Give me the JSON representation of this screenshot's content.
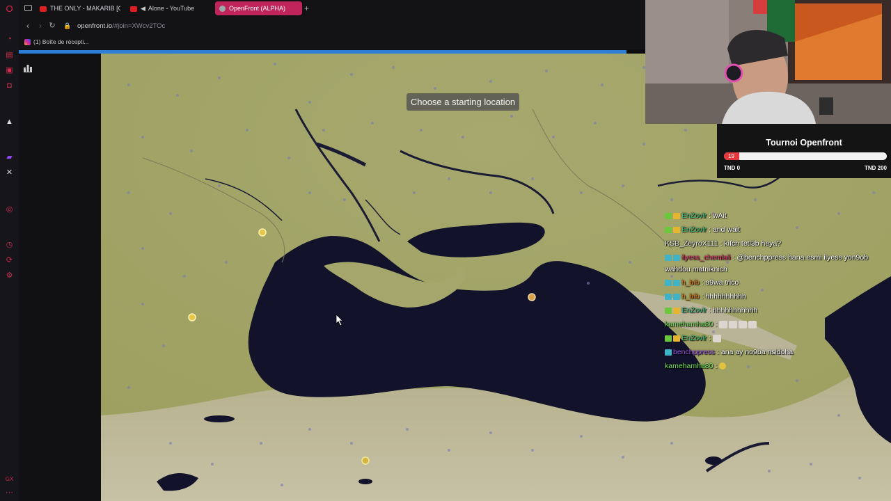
{
  "browser": {
    "tabs": [
      {
        "label": "THE ONLY - MAKARIB [O",
        "icon": "youtube-icon"
      },
      {
        "label": "Alone - YouTube",
        "icon": "youtube-icon"
      },
      {
        "label": "OpenFront (ALPHA)",
        "icon": "globe-icon",
        "active": true
      }
    ],
    "new_tab_label": "+",
    "url_host": "openfront.io",
    "url_path": "/#join=XWcv2TOc",
    "bookmark_label": "(1) Boîte de récepti..."
  },
  "game": {
    "banner": "Choose a starting location"
  },
  "goal_widget": {
    "title": "Tournoi Openfront",
    "current": "19",
    "progress_fraction": 0.095,
    "min_label": "TND 0",
    "max_label": "TND 200",
    "fill_color": "#e5393f"
  },
  "chat": [
    {
      "badges": [
        "green",
        "gold"
      ],
      "user": "EnZovlr",
      "user_color": "#3bc07c",
      "msg": "wAit"
    },
    {
      "badges": [
        "green",
        "gold"
      ],
      "user": "EnZovlr",
      "user_color": "#3bc07c",
      "msg": "and wait"
    },
    {
      "badges": [],
      "user": "KSB_ZeyroX111",
      "user_color": "#e8e8e8",
      "msg": "kifch tetl3b heya?"
    },
    {
      "badges": [
        "teal",
        "teal"
      ],
      "user": "ilyess_chemlali",
      "user_color": "#e0336a",
      "msg": "@benchppress hana esmi ilyess yon9ob wahdou matniknich",
      "wrap": true
    },
    {
      "badges": [
        "teal",
        "teal"
      ],
      "user": "h_bib",
      "user_color": "#e07a1f",
      "msg": "a9wa trico"
    },
    {
      "badges": [
        "teal",
        "teal"
      ],
      "user": "h_bib",
      "user_color": "#e07a1f",
      "msg": "hhhhhhhhhh"
    },
    {
      "badges": [
        "green",
        "gold"
      ],
      "user": "EnZovlr",
      "user_color": "#3bc07c",
      "msg": "hhhhhhhhhhh"
    },
    {
      "badges": [],
      "user": "kamehamha80",
      "user_color": "#74e35b",
      "msg": "",
      "emotes": 4
    },
    {
      "badges": [
        "green",
        "gold"
      ],
      "user": "EnZovlr",
      "user_color": "#3bc07c",
      "msg": "",
      "emotes": 1
    },
    {
      "badges": [
        "teal"
      ],
      "user": "benchppress",
      "user_color": "#a056e8",
      "msg": "ana ay no9ba nsidoha"
    },
    {
      "badges": [],
      "user": "kamehamha80",
      "user_color": "#74e35b",
      "msg": "",
      "emotes": 1,
      "round": true
    }
  ],
  "colors": {
    "sea": "#12132a",
    "land": "#a3a56c",
    "accent": "#c0245a"
  }
}
